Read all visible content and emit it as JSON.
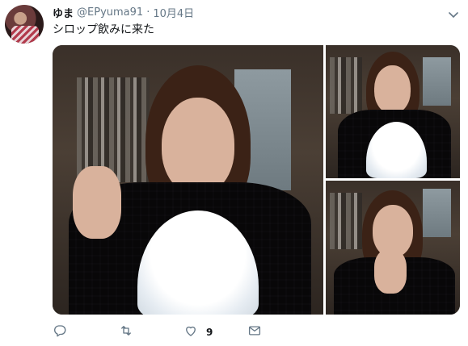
{
  "tweet": {
    "author_name": "ゆま",
    "handle": "@EPyuma91",
    "separator": "·",
    "date": "10月4日",
    "text": "シロップ飲みに来た"
  },
  "actions": {
    "reply_icon": "reply-icon",
    "retweet_icon": "retweet-icon",
    "like_icon": "heart-icon",
    "like_count": "9",
    "dm_icon": "envelope-icon"
  },
  "media": {
    "photo_count": 3
  },
  "colors": {
    "text_primary": "#14171a",
    "text_secondary": "#657786"
  }
}
